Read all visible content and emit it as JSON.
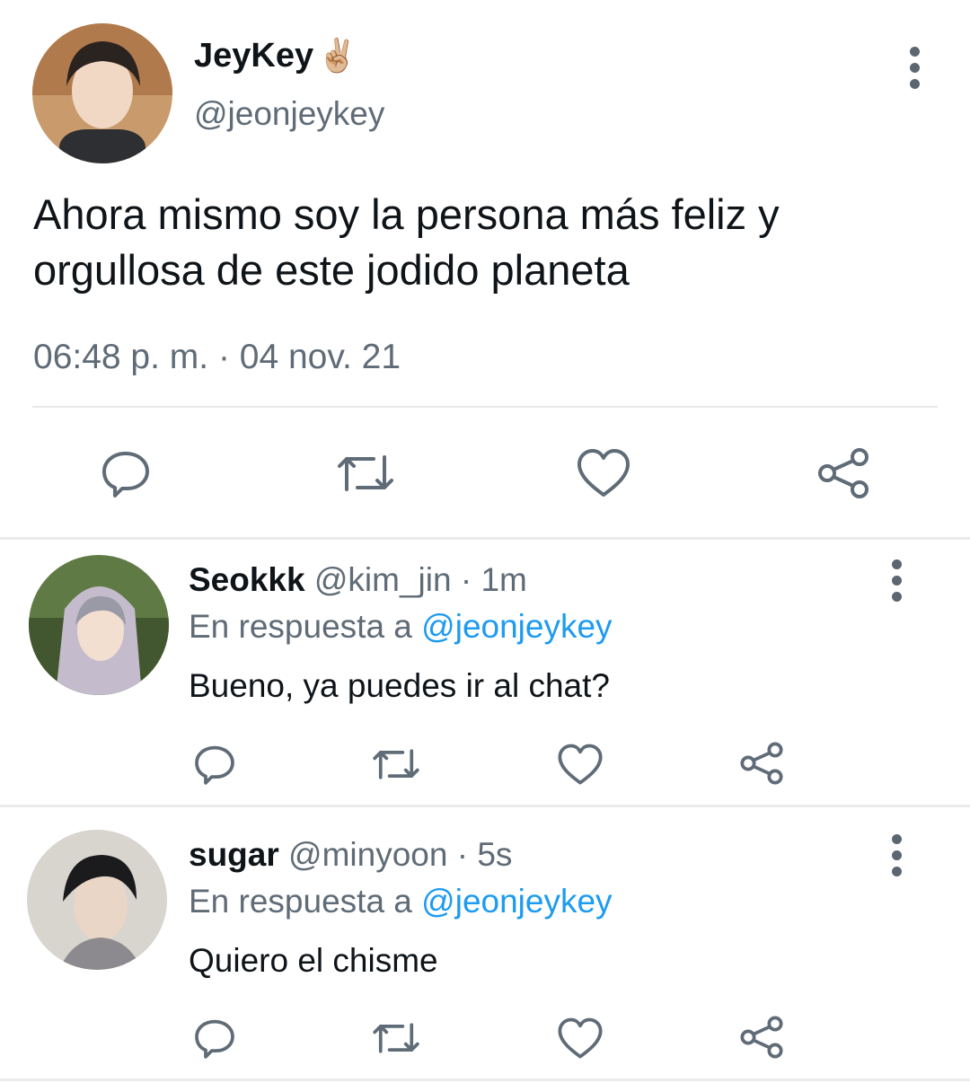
{
  "colors": {
    "link": "#1d9bf0",
    "muted": "#5f6b76",
    "icon": "#657786",
    "text": "#0f1419"
  },
  "main_tweet": {
    "display_name": "JeyKey",
    "emoji": "✌🏼",
    "handle": "@jeonjeykey",
    "text_line1": "Ahora mismo soy la persona más feliz y",
    "text_line2": "orgullosa de este jodido planeta",
    "timestamp": "06:48 p. m. · 04 nov. 21",
    "actions": [
      "reply-icon",
      "retweet-icon",
      "like-icon",
      "share-icon"
    ]
  },
  "replies": [
    {
      "display_name": "Seokkk",
      "handle": "@kim_jin",
      "time": "· 1m",
      "reply_prefix": "En respuesta a",
      "reply_to": "@jeonjeykey",
      "text": "Bueno, ya puedes ir al chat?"
    },
    {
      "display_name": "sugar",
      "handle": "@minyoon",
      "time": "· 5s",
      "reply_prefix": "En respuesta a",
      "reply_to": "@jeonjeykey",
      "text": "Quiero el chisme"
    }
  ]
}
